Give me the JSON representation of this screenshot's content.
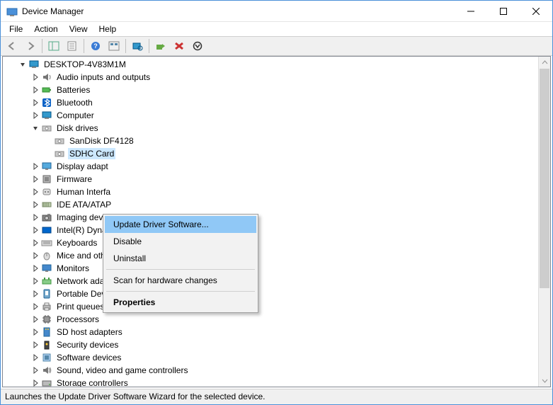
{
  "window": {
    "title": "Device Manager"
  },
  "menubar": {
    "file": "File",
    "action": "Action",
    "view": "View",
    "help": "Help"
  },
  "toolbar_icons": {
    "back": "back-arrow",
    "forward": "forward-arrow",
    "show_hide": "show-hide-console-tree",
    "properties": "properties",
    "help": "help",
    "view_mode": "view-devices-by-type",
    "scan": "scan-for-hardware-changes",
    "update": "update-driver",
    "uninstall": "uninstall",
    "disable": "disable"
  },
  "tree": {
    "root": "DESKTOP-4V83M1M",
    "items": [
      {
        "label": "Audio inputs and outputs",
        "icon": "speaker"
      },
      {
        "label": "Batteries",
        "icon": "battery"
      },
      {
        "label": "Bluetooth",
        "icon": "bluetooth"
      },
      {
        "label": "Computer",
        "icon": "computer"
      },
      {
        "label": "Disk drives",
        "icon": "disk",
        "expanded": true,
        "children": [
          {
            "label": "SanDisk DF4128",
            "icon": "disk"
          },
          {
            "label": "SDHC Card",
            "icon": "disk",
            "selected": true
          }
        ]
      },
      {
        "label": "Display adapt",
        "icon": "display",
        "truncated": true
      },
      {
        "label": "Firmware",
        "icon": "firmware"
      },
      {
        "label": "Human Interfa",
        "icon": "hid",
        "truncated": true
      },
      {
        "label": "IDE ATA/ATAP",
        "icon": "ide",
        "truncated": true
      },
      {
        "label": "Imaging devic",
        "icon": "camera",
        "truncated": true
      },
      {
        "label": "Intel(R) Dynar",
        "icon": "intel",
        "truncated": true
      },
      {
        "label": "Keyboards",
        "icon": "keyboard"
      },
      {
        "label": "Mice and other pointing devices",
        "icon": "mouse"
      },
      {
        "label": "Monitors",
        "icon": "monitor"
      },
      {
        "label": "Network adapters",
        "icon": "network"
      },
      {
        "label": "Portable Devices",
        "icon": "portable"
      },
      {
        "label": "Print queues",
        "icon": "printer"
      },
      {
        "label": "Processors",
        "icon": "cpu"
      },
      {
        "label": "SD host adapters",
        "icon": "sd"
      },
      {
        "label": "Security devices",
        "icon": "security"
      },
      {
        "label": "Software devices",
        "icon": "software"
      },
      {
        "label": "Sound, video and game controllers",
        "icon": "sound"
      },
      {
        "label": "Storage controllers",
        "icon": "storage",
        "cutoff": true
      }
    ]
  },
  "context_menu": {
    "items": [
      {
        "label": "Update Driver Software...",
        "highlighted": true
      },
      {
        "label": "Disable"
      },
      {
        "label": "Uninstall"
      },
      {
        "sep": true
      },
      {
        "label": "Scan for hardware changes"
      },
      {
        "sep": true
      },
      {
        "label": "Properties",
        "bold": true
      }
    ]
  },
  "statusbar": {
    "text": "Launches the Update Driver Software Wizard for the selected device."
  }
}
